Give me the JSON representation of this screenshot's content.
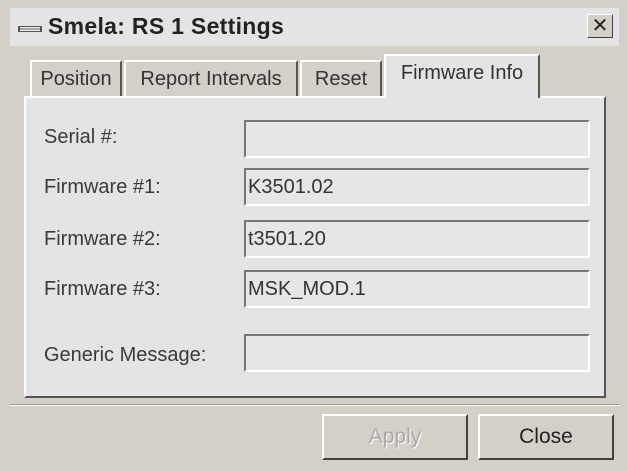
{
  "window": {
    "title": "Smela: RS 1 Settings",
    "close_glyph": "✕"
  },
  "tabs": [
    {
      "label": "Position",
      "active": false
    },
    {
      "label": "Report Intervals",
      "active": false
    },
    {
      "label": "Reset",
      "active": false
    },
    {
      "label": "Firmware Info",
      "active": true
    }
  ],
  "fields": [
    {
      "label": "Serial #:",
      "value": ""
    },
    {
      "label": "Firmware #1:",
      "value": "K3501.02"
    },
    {
      "label": "Firmware #2:",
      "value": "t3501.20"
    },
    {
      "label": "Firmware #3:",
      "value": "MSK_MOD.1"
    },
    {
      "label": "Generic Message:",
      "value": ""
    }
  ],
  "buttons": {
    "apply": {
      "label": "Apply",
      "enabled": false
    },
    "close": {
      "label": "Close",
      "enabled": true
    }
  },
  "colors": {
    "face": "#d4d0c8",
    "panel": "#e4e4e4",
    "disabled_text": "#a8a8a8"
  }
}
